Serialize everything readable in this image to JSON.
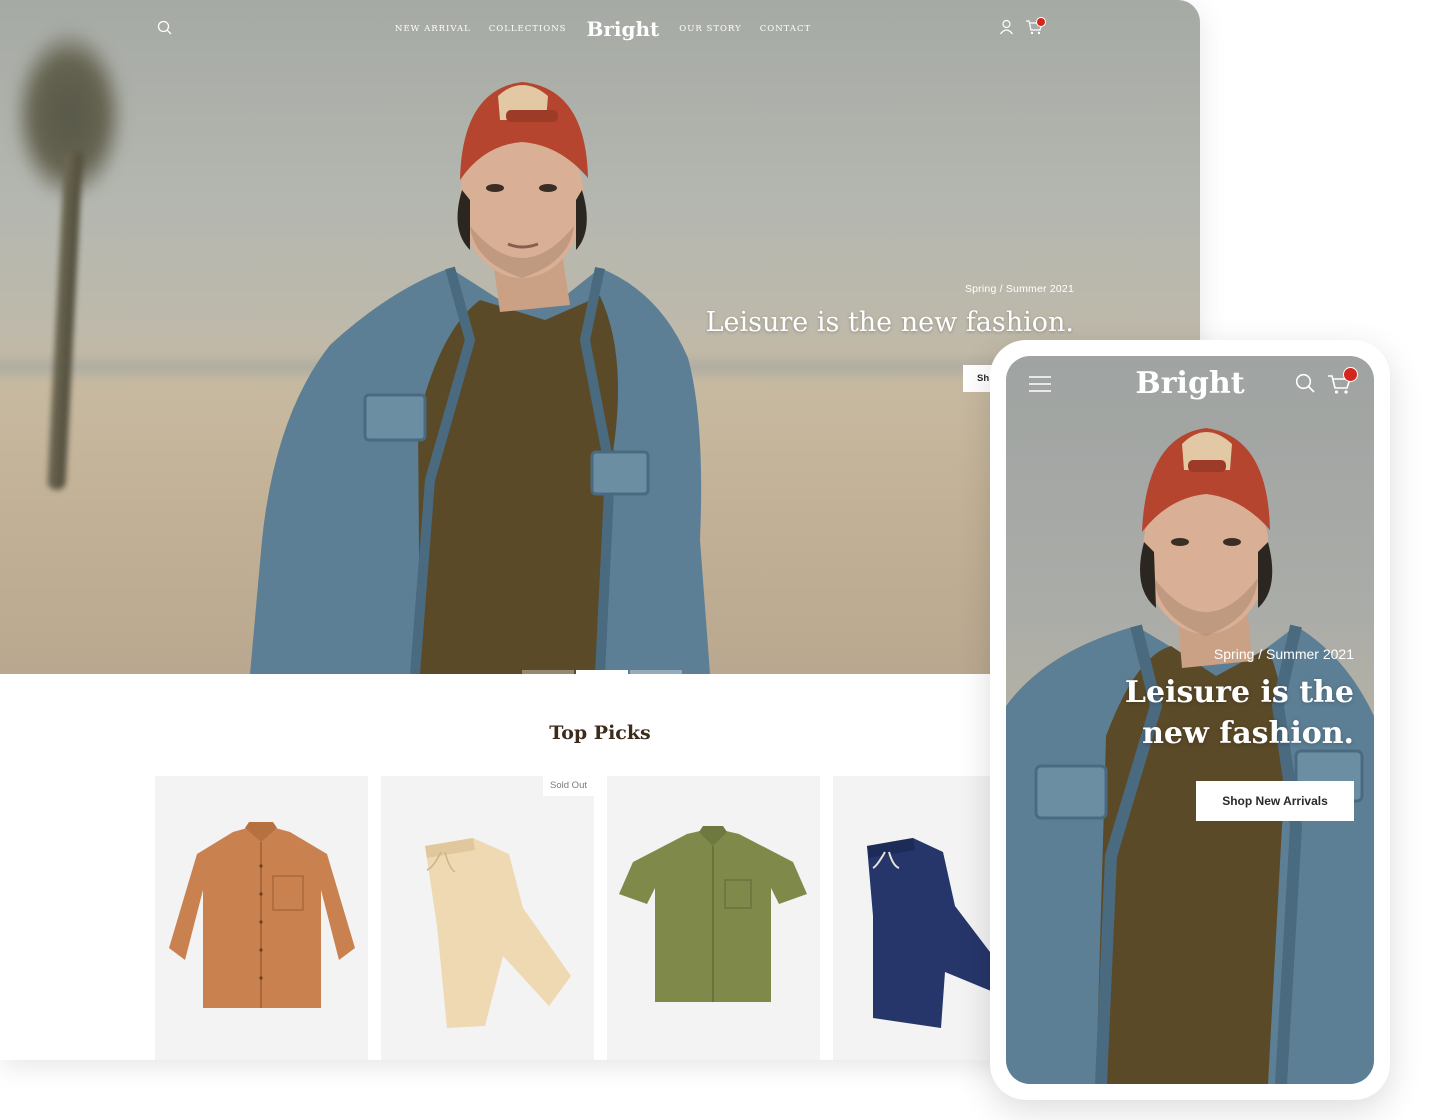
{
  "desktop": {
    "brand": "Bright",
    "nav_left": [
      "NEW ARRIVAL",
      "COLLECTIONS"
    ],
    "nav_right": [
      "OUR STORY",
      "CONTACT"
    ],
    "hero": {
      "kicker": "Spring / Summer 2021",
      "headline": "Leisure is the new fashion.",
      "cta_label": "Sh"
    },
    "carousel": {
      "slides": 3,
      "active_index": 1
    },
    "section_title": "Top Picks",
    "products": [
      {
        "item": "orange long-sleeve shirt",
        "color": "#c9824f",
        "badge": ""
      },
      {
        "item": "cream drawstring pants",
        "color": "#efd9b3",
        "badge": "Sold Out"
      },
      {
        "item": "olive short-sleeve shirt",
        "color": "#7f8a4a",
        "badge": ""
      },
      {
        "item": "navy drawstring pants",
        "color": "#26366a",
        "badge": ""
      }
    ]
  },
  "mobile": {
    "brand": "Bright",
    "hero": {
      "kicker": "Spring / Summer 2021",
      "headline_line1": "Leisure is the",
      "headline_line2": "new fashion.",
      "cta_label": "Shop New Arrivals"
    }
  },
  "colors": {
    "badge": "#d3261d",
    "heading": "#3b2c1b",
    "cap": "#b5452e",
    "jacket": "#5d7f95",
    "tshirt": "#5b4a28"
  }
}
